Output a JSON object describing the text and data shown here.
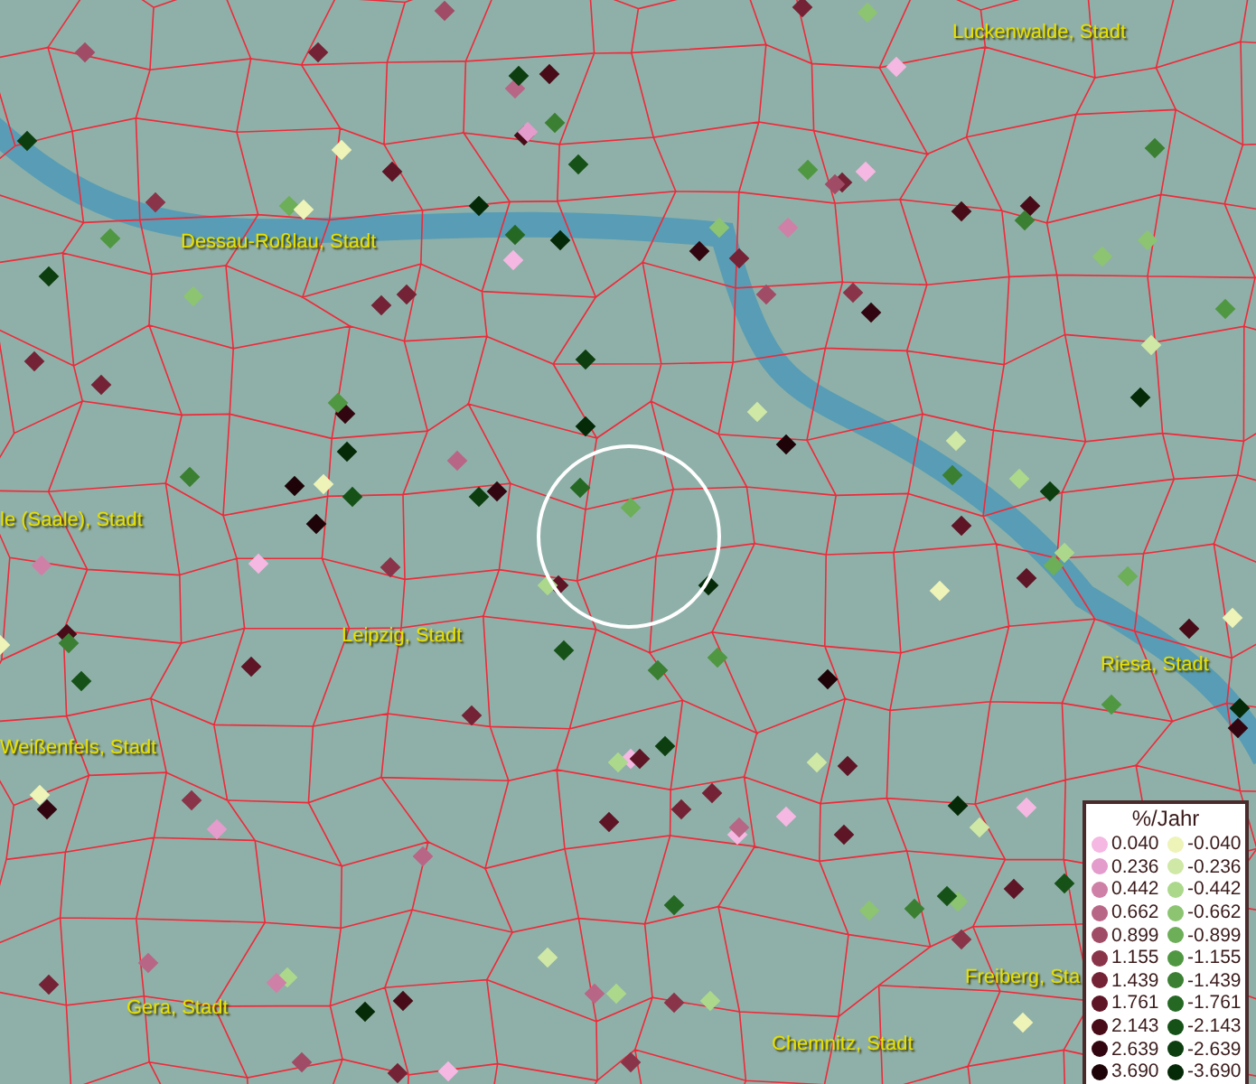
{
  "map": {
    "places": [
      {
        "name": "Luckenwalde, Stadt"
      },
      {
        "name": "Dessau-Roßlau, Stadt"
      },
      {
        "name": "le (Saale), Stadt"
      },
      {
        "name": "Leipzig, Stadt"
      },
      {
        "name": "Weißenfels, Stadt"
      },
      {
        "name": "Riesa, Stadt"
      },
      {
        "name": "Gera, Stadt"
      },
      {
        "name": "Chemnitz, Stadt"
      },
      {
        "name": "Freiberg, Sta"
      }
    ]
  },
  "legend": {
    "title": "%/Jahr",
    "rows": [
      {
        "positive": {
          "value": "0.040",
          "color": "#f4b8e2"
        },
        "negative": {
          "value": "-0.040",
          "color": "#eef3b8"
        }
      },
      {
        "positive": {
          "value": "0.236",
          "color": "#e39ccb"
        },
        "negative": {
          "value": "-0.236",
          "color": "#cfe8a6"
        }
      },
      {
        "positive": {
          "value": "0.442",
          "color": "#cf80a6"
        },
        "negative": {
          "value": "-0.442",
          "color": "#acd88c"
        }
      },
      {
        "positive": {
          "value": "0.662",
          "color": "#b86686"
        },
        "negative": {
          "value": "-0.662",
          "color": "#8cc472"
        }
      },
      {
        "positive": {
          "value": "0.899",
          "color": "#a04c66"
        },
        "negative": {
          "value": "-0.899",
          "color": "#6dae58"
        }
      },
      {
        "positive": {
          "value": "1.155",
          "color": "#8a3449"
        },
        "negative": {
          "value": "-1.155",
          "color": "#509742"
        }
      },
      {
        "positive": {
          "value": "1.439",
          "color": "#742336"
        },
        "negative": {
          "value": "-1.439",
          "color": "#3a7f32"
        }
      },
      {
        "positive": {
          "value": "1.761",
          "color": "#5e1526"
        },
        "negative": {
          "value": "-1.761",
          "color": "#256824"
        }
      },
      {
        "positive": {
          "value": "2.143",
          "color": "#470c18"
        },
        "negative": {
          "value": "-2.143",
          "color": "#165218"
        }
      },
      {
        "positive": {
          "value": "2.639",
          "color": "#320610"
        },
        "negative": {
          "value": "-2.639",
          "color": "#0c3e10"
        }
      },
      {
        "positive": {
          "value": "3.690",
          "color": "#1e0308"
        },
        "negative": {
          "value": "-3.690",
          "color": "#052a08"
        }
      }
    ]
  }
}
